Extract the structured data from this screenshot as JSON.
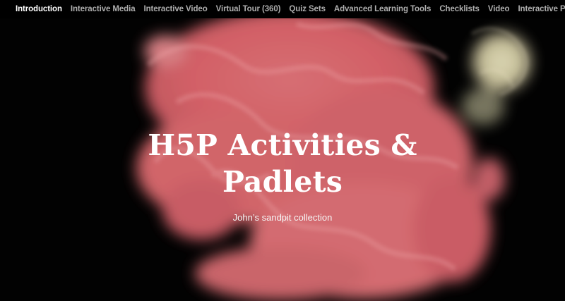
{
  "navigation": {
    "items": [
      {
        "label": "Introduction",
        "active": true
      },
      {
        "label": "Interactive Media",
        "active": false
      },
      {
        "label": "Interactive Video",
        "active": false
      },
      {
        "label": "Virtual Tour (360)",
        "active": false
      },
      {
        "label": "Quiz Sets",
        "active": false
      },
      {
        "label": "Advanced Learning Tools",
        "active": false
      },
      {
        "label": "Checklists",
        "active": false
      },
      {
        "label": "Video",
        "active": false
      },
      {
        "label": "Interactive Padlet",
        "active": false
      }
    ]
  },
  "hero": {
    "title": "H5P Activities & Padlets",
    "subtitle": "John’s sandpit collection",
    "background": "#030303",
    "accent": "#e46e74"
  }
}
